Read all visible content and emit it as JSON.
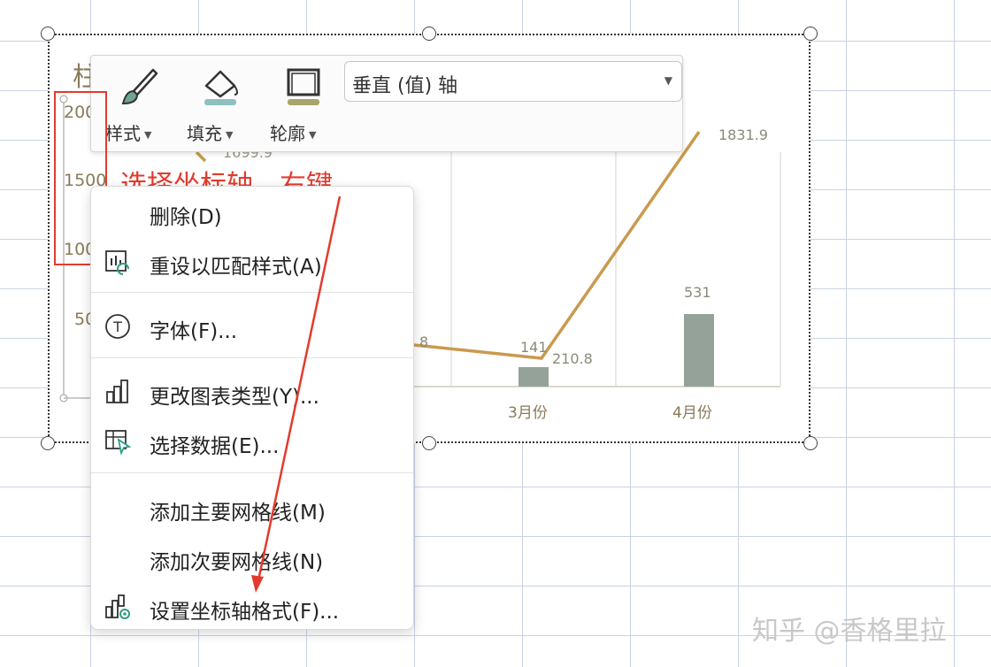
{
  "chart": {
    "title_fragment": "柱",
    "y_ticks": [
      "200",
      "1500",
      "100",
      "50"
    ],
    "x_ticks": [
      "3月份",
      "4月份"
    ],
    "data_labels": [
      "1699.9",
      "8",
      "141",
      "210.8",
      "531",
      "1831.9"
    ]
  },
  "toolbar": {
    "style_label": "样式",
    "fill_label": "填充",
    "outline_label": "轮廓",
    "axis_selector_value": "垂直 (值) 轴"
  },
  "annotation": {
    "text": "选择坐标轴，右键"
  },
  "context_menu": {
    "items": [
      {
        "label": "删除(D)",
        "icon": "none"
      },
      {
        "label": "重设以匹配样式(A)",
        "icon": "reset-style-icon"
      },
      {
        "label": "字体(F)...",
        "icon": "font-icon"
      },
      {
        "label": "更改图表类型(Y)...",
        "icon": "chart-type-icon"
      },
      {
        "label": "选择数据(E)...",
        "icon": "select-data-icon"
      },
      {
        "label": "添加主要网格线(M)",
        "icon": "none"
      },
      {
        "label": "添加次要网格线(N)",
        "icon": "none"
      },
      {
        "label": "设置坐标轴格式(F)...",
        "icon": "format-axis-icon"
      }
    ]
  },
  "watermark": "知乎 @香格里拉",
  "colors": {
    "line": "#c99a4e",
    "bar": "#94a29a",
    "annotation": "#e23b2e"
  }
}
